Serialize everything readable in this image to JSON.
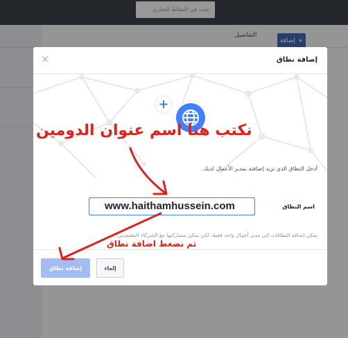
{
  "topbar": {
    "search_placeholder": "بحث في النشاط التجاري"
  },
  "background": {
    "details_label": "التفاصيل",
    "add_button_label": "إضافة",
    "add_plus": "+"
  },
  "dialog": {
    "title": "إضافة نطاق",
    "close_glyph": "×",
    "plus_glyph": "+",
    "instructions": "أدخل النطاق الذي تريد إضافته بمدير الأعمال لديك.",
    "field_label": "اسم النطاق",
    "domain_value": "www.haithamhussein.com",
    "note": "يمكن إضافة النطاقات إلى مدير أعمال واحد فقط، لكن يمكن مشاركتها مع الشركاء المعتمدين.",
    "add_button": "إضافة نطاق",
    "cancel_button": "إلغاء"
  },
  "annotations": {
    "top": "نكتب هنا اسم عنوان الدومين",
    "bottom": "ثم نضغط اضافة نطاق"
  },
  "colors": {
    "accent": "#4080ff",
    "annotation": "#e0201b",
    "topbar": "#3b4048"
  },
  "icons": {
    "globe": "globe-icon",
    "plus": "plus-icon",
    "close": "close-icon"
  }
}
